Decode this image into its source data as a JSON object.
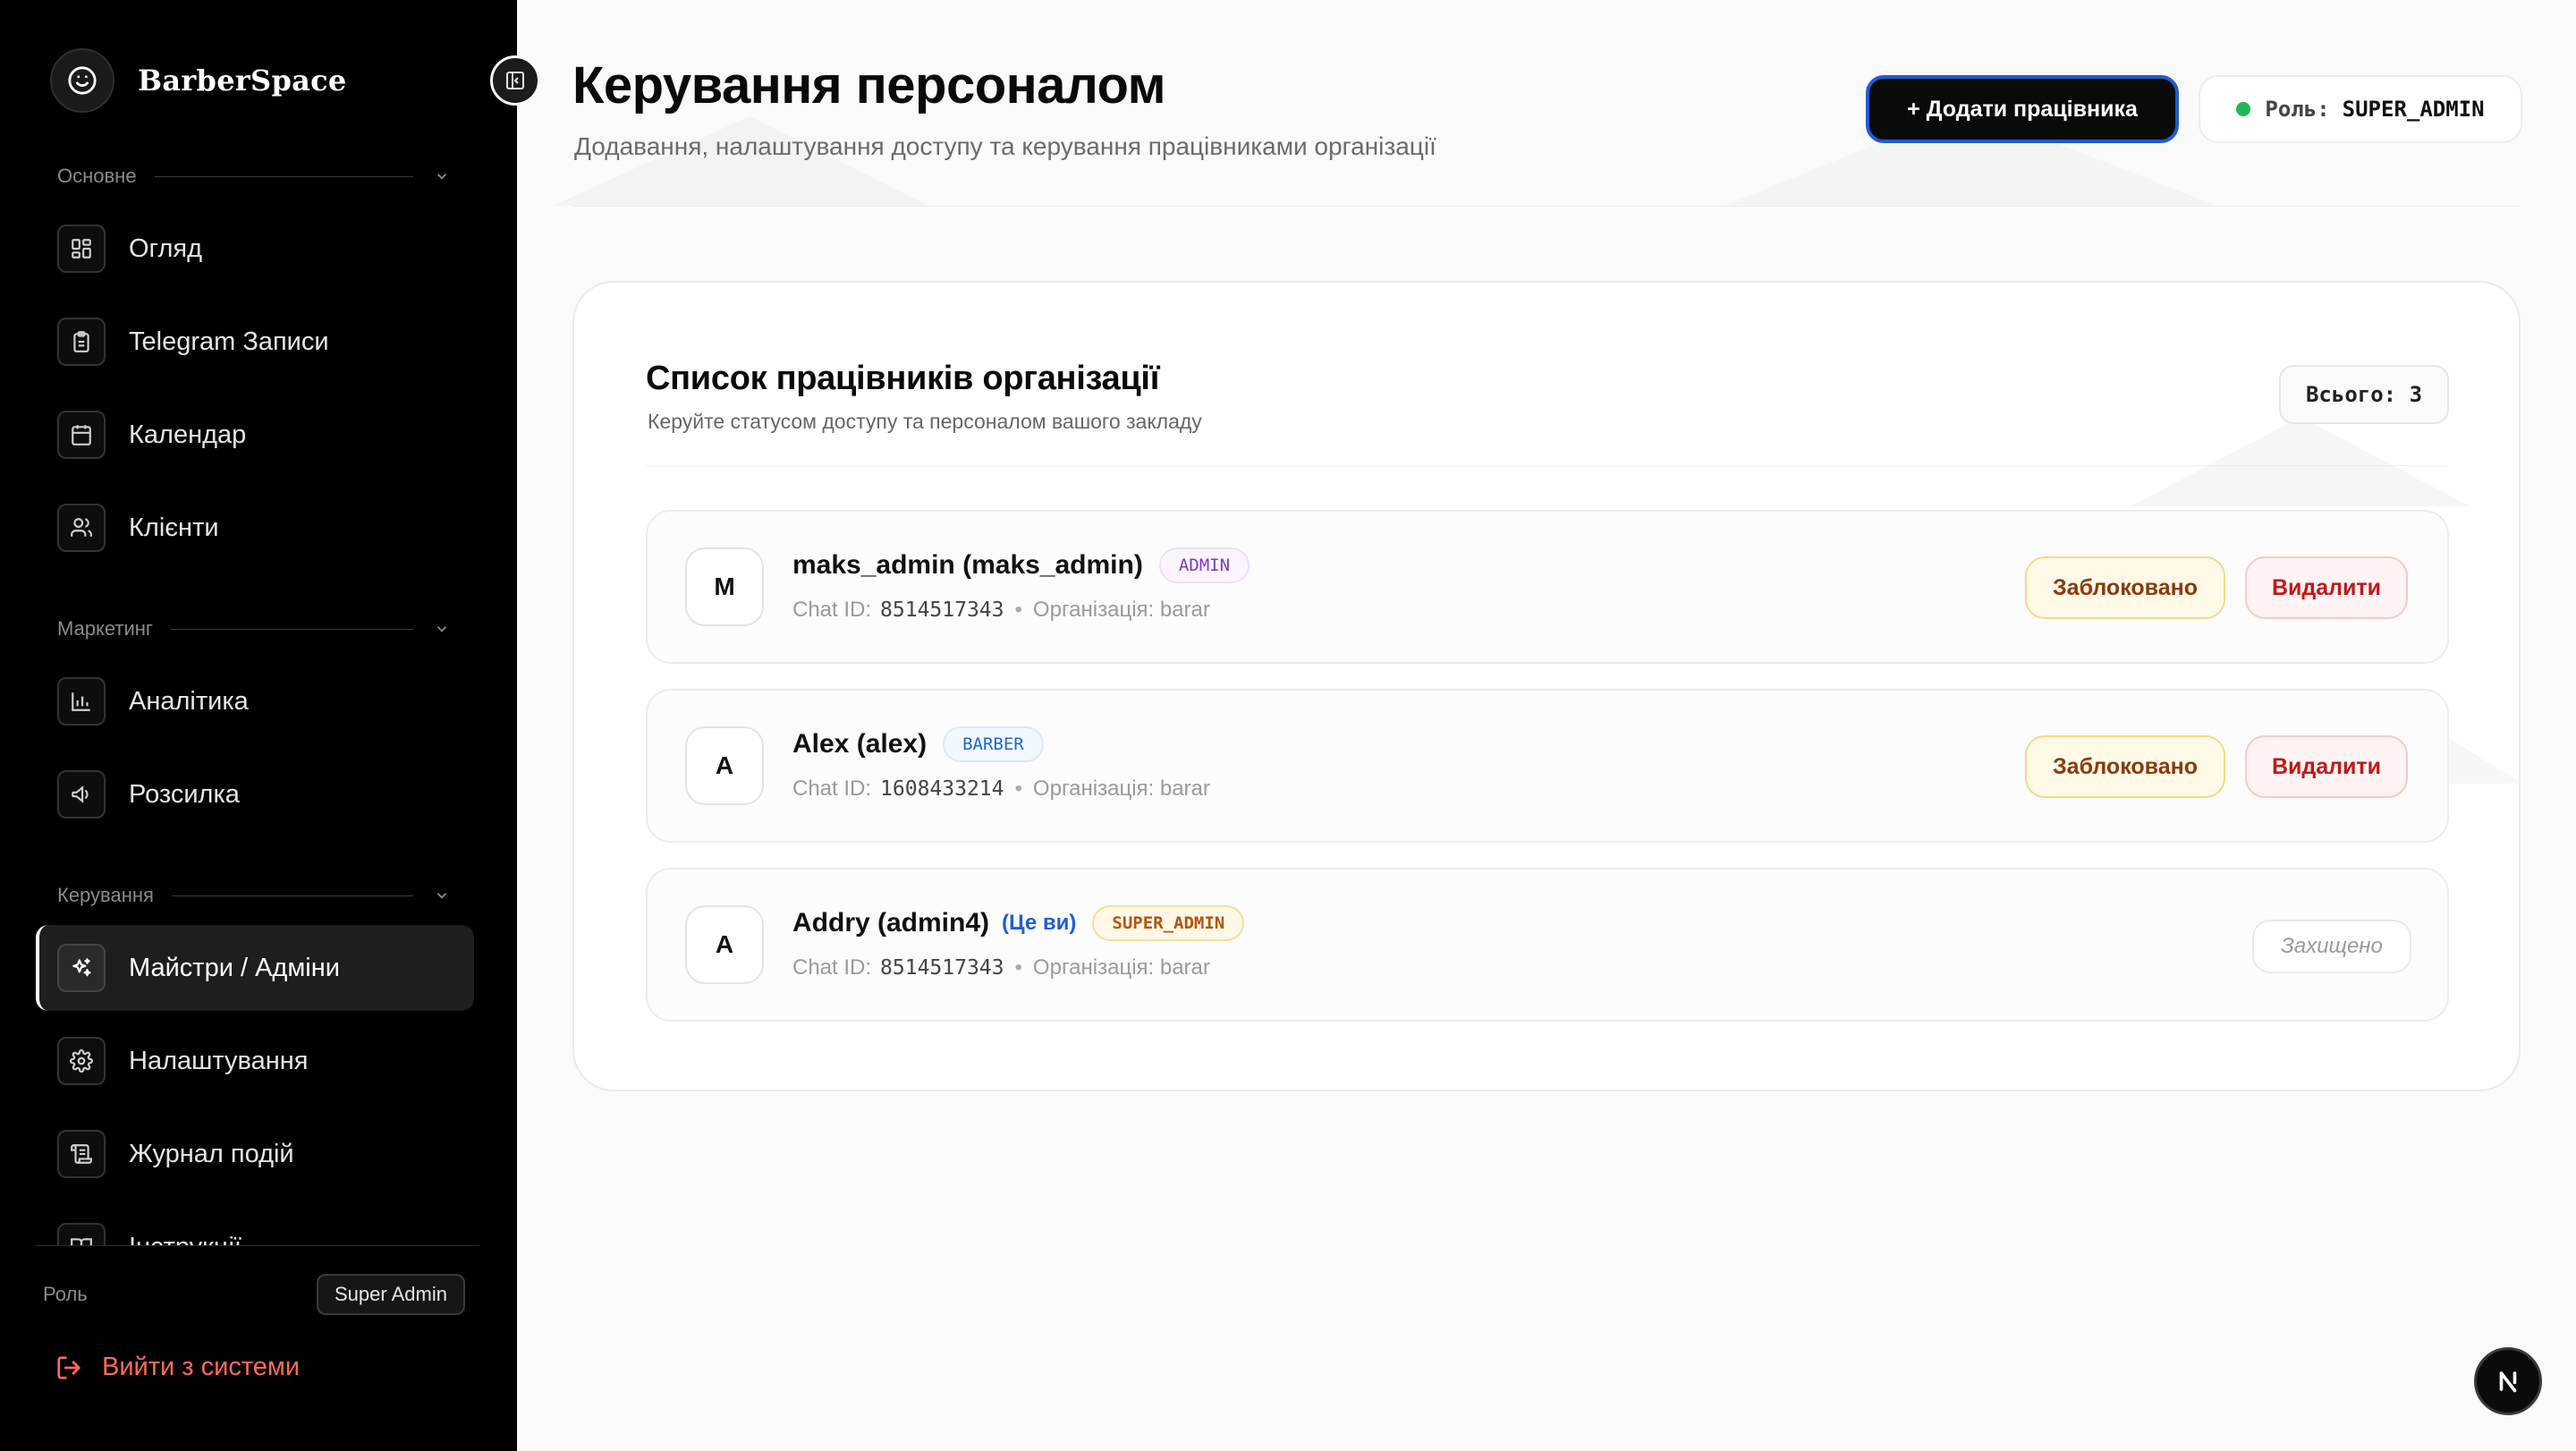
{
  "app": {
    "brand": "BarberSpace"
  },
  "sidebar": {
    "sections": {
      "main": "Основне",
      "marketing": "Маркетинг",
      "management": "Керування"
    },
    "items": [
      {
        "label": "Огляд",
        "icon": "grid-icon"
      },
      {
        "label": "Telegram Записи",
        "icon": "clipboard-icon"
      },
      {
        "label": "Календар",
        "icon": "calendar-icon"
      },
      {
        "label": "Клієнти",
        "icon": "users-icon"
      },
      {
        "label": "Аналітика",
        "icon": "bar-chart-icon"
      },
      {
        "label": "Розсилка",
        "icon": "megaphone-icon"
      },
      {
        "label": "Майстри / Адміни",
        "icon": "sparkles-icon",
        "active": true
      },
      {
        "label": "Налаштування",
        "icon": "gear-icon"
      },
      {
        "label": "Журнал подій",
        "icon": "scroll-icon"
      },
      {
        "label": "Інструкції",
        "icon": "book-icon"
      }
    ],
    "role_label": "Роль",
    "role_value": "Super Admin",
    "logout": "Вийти з системи"
  },
  "header": {
    "title": "Керування персоналом",
    "subtitle": "Додавання, налаштування доступу та керування працівниками організації",
    "add_button": "+ Додати працівника",
    "role_prefix": "Роль:",
    "role_value": "SUPER_ADMIN"
  },
  "employees_card": {
    "title": "Список працівників організації",
    "subtitle": "Керуйте статусом доступу та персоналом вашого закладу",
    "total": "Всього: 3",
    "chat_id_label": "Chat ID:",
    "org_label": "Організація: barar",
    "rows": [
      {
        "initial": "M",
        "name": "maks_admin (maks_admin)",
        "role": "ADMIN",
        "chat_id": "8514517343",
        "block_label": "Заблоковано",
        "delete_label": "Видалити"
      },
      {
        "initial": "A",
        "name": "Alex (alex)",
        "role": "BARBER",
        "chat_id": "1608433214",
        "block_label": "Заблоковано",
        "delete_label": "Видалити"
      },
      {
        "initial": "A",
        "name": "Addry (admin4)",
        "you": "(Це ви)",
        "role": "SUPER_ADMIN",
        "chat_id": "8514517343",
        "protected_label": "Захищено"
      }
    ]
  },
  "colors": {
    "accent": "#1e5bd8",
    "status_dot": "#1db954",
    "danger": "#c01818",
    "warning": "#8a3b0b",
    "logout": "#ff6a5a"
  }
}
